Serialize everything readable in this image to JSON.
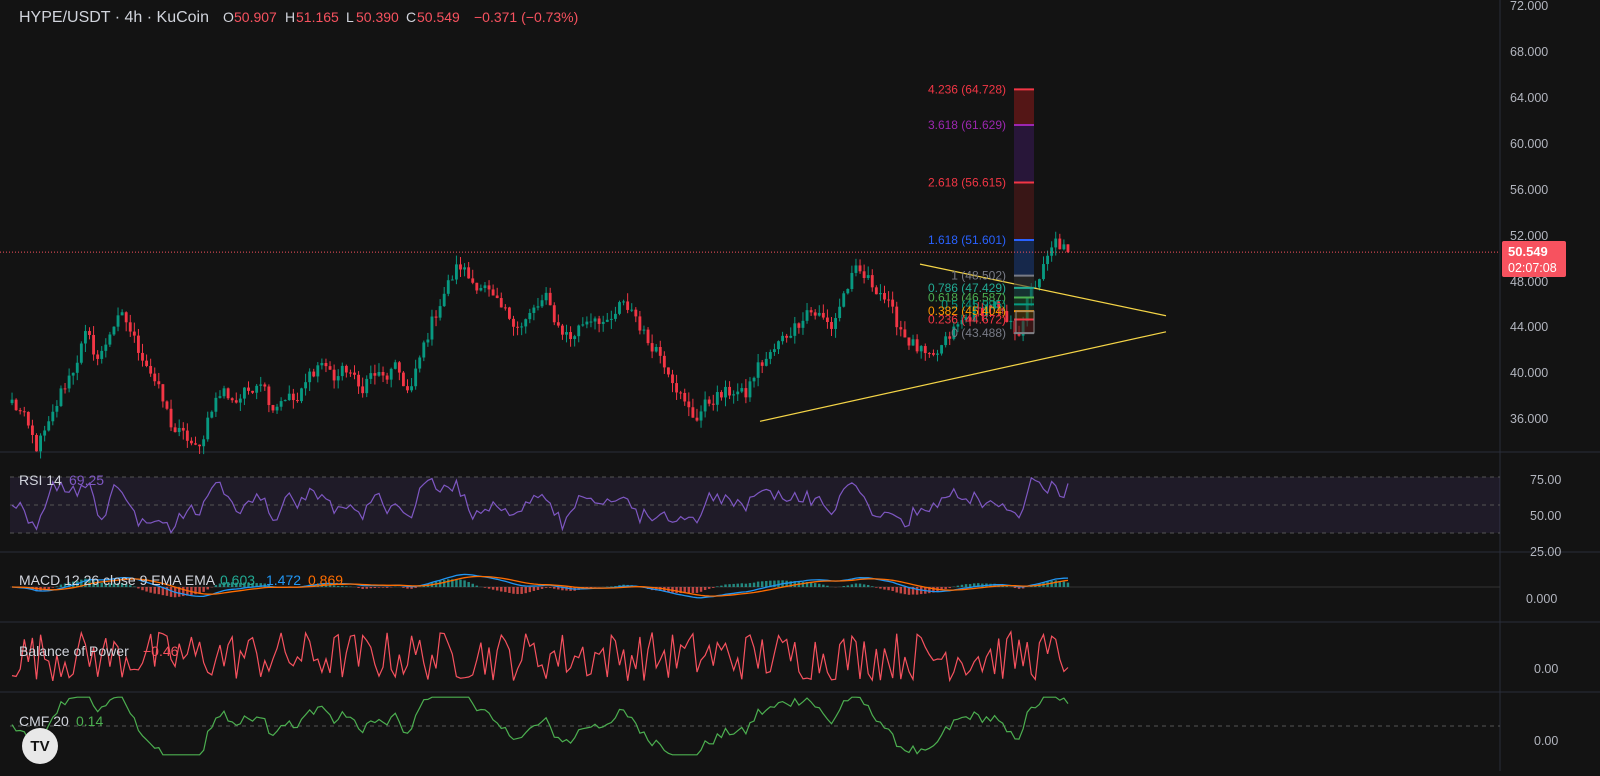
{
  "header": {
    "symbol": "HYPE/USDT · 4h · KuCoin",
    "open_key": "O",
    "open": "50.907",
    "high_key": "H",
    "high": "51.165",
    "low_key": "L",
    "low": "50.390",
    "close_key": "C",
    "close": "50.549",
    "change": "−0.371 (−0.73%)"
  },
  "price_axis": {
    "ticks": [
      "72.000",
      "68.000",
      "64.000",
      "60.000",
      "56.000",
      "52.000",
      "48.000",
      "44.000",
      "40.000",
      "36.000"
    ],
    "last_price": "50.549",
    "countdown": "02:07:08"
  },
  "fib_levels": [
    {
      "label": "4.236 (64.728)",
      "value": 64.728,
      "color": "#f23645"
    },
    {
      "label": "3.618 (61.629)",
      "value": 61.629,
      "color": "#9c27b0"
    },
    {
      "label": "2.618 (56.615)",
      "value": 56.615,
      "color": "#f23645"
    },
    {
      "label": "1.618 (51.601)",
      "value": 51.601,
      "color": "#2962ff"
    },
    {
      "label": "1 (48.502)",
      "value": 48.502,
      "color": "#787b86"
    },
    {
      "label": "0.786 (47.429)",
      "value": 47.429,
      "color": "#22ab94"
    },
    {
      "label": "0.618 (46.587)",
      "value": 46.587,
      "color": "#4caf50"
    },
    {
      "label": "0.5 (45.995)",
      "value": 45.995,
      "color": "#089981"
    },
    {
      "label": "0.382 (45.404)",
      "value": 45.404,
      "color": "#ff9800"
    },
    {
      "label": "0.236 (44.672)",
      "value": 44.672,
      "color": "#f23645"
    },
    {
      "label": "0 (43.488)",
      "value": 43.488,
      "color": "#787b86"
    }
  ],
  "indicators": {
    "rsi": {
      "title": "RSI 14",
      "value": "69.25",
      "ticks": [
        "75.00",
        "50.00",
        "25.00"
      ],
      "color": "#7e57c2"
    },
    "macd": {
      "title": "MACD 12 26 close 9 EMA EMA",
      "v1": "0.603",
      "v2": "1.472",
      "v3": "0.869",
      "tick": "0.000"
    },
    "bop": {
      "title": "Balance of Power",
      "value": "−0.46",
      "tick": "0.00"
    },
    "cmf": {
      "title": "CMF 20",
      "value": "0.14",
      "tick": "0.00"
    }
  },
  "logo": {
    "text": "TV"
  },
  "colors": {
    "up": "#089981",
    "down": "#f23645",
    "bg": "#131313",
    "accent": "#f7525f"
  },
  "chart_data": {
    "type": "candlestick",
    "symbol": "HYPE/USDT",
    "interval": "4h",
    "ylim": [
      32.5,
      72
    ],
    "close_path": [
      37.5,
      36.0,
      33.5,
      35.5,
      38.5,
      40.5,
      43.5,
      41.0,
      44.0,
      45.0,
      42.5,
      40.5,
      38.0,
      35.0,
      34.5,
      33.0,
      37.0,
      38.5,
      37.5,
      38.5,
      39.5,
      37.0,
      38.0,
      37.5,
      40.0,
      41.0,
      39.5,
      40.5,
      38.5,
      40.0,
      39.5,
      40.5,
      38.0,
      42.0,
      45.0,
      47.5,
      49.5,
      48.0,
      47.5,
      46.0,
      45.0,
      44.0,
      45.5,
      46.5,
      44.0,
      43.0,
      44.5,
      45.0,
      44.0,
      46.0,
      45.5,
      43.0,
      42.0,
      40.0,
      37.5,
      36.0,
      37.5,
      38.0,
      38.5,
      38.0,
      40.5,
      41.5,
      43.0,
      44.0,
      45.5,
      45.0,
      44.0,
      47.0,
      49.0,
      48.0,
      47.0,
      45.0,
      43.0,
      42.0,
      41.0,
      42.5,
      44.0,
      45.0,
      45.5,
      46.0,
      44.5,
      43.5,
      47.0,
      49.0,
      51.5,
      50.5
    ],
    "last": {
      "open": 50.907,
      "high": 51.165,
      "low": 50.39,
      "close": 50.549
    }
  }
}
